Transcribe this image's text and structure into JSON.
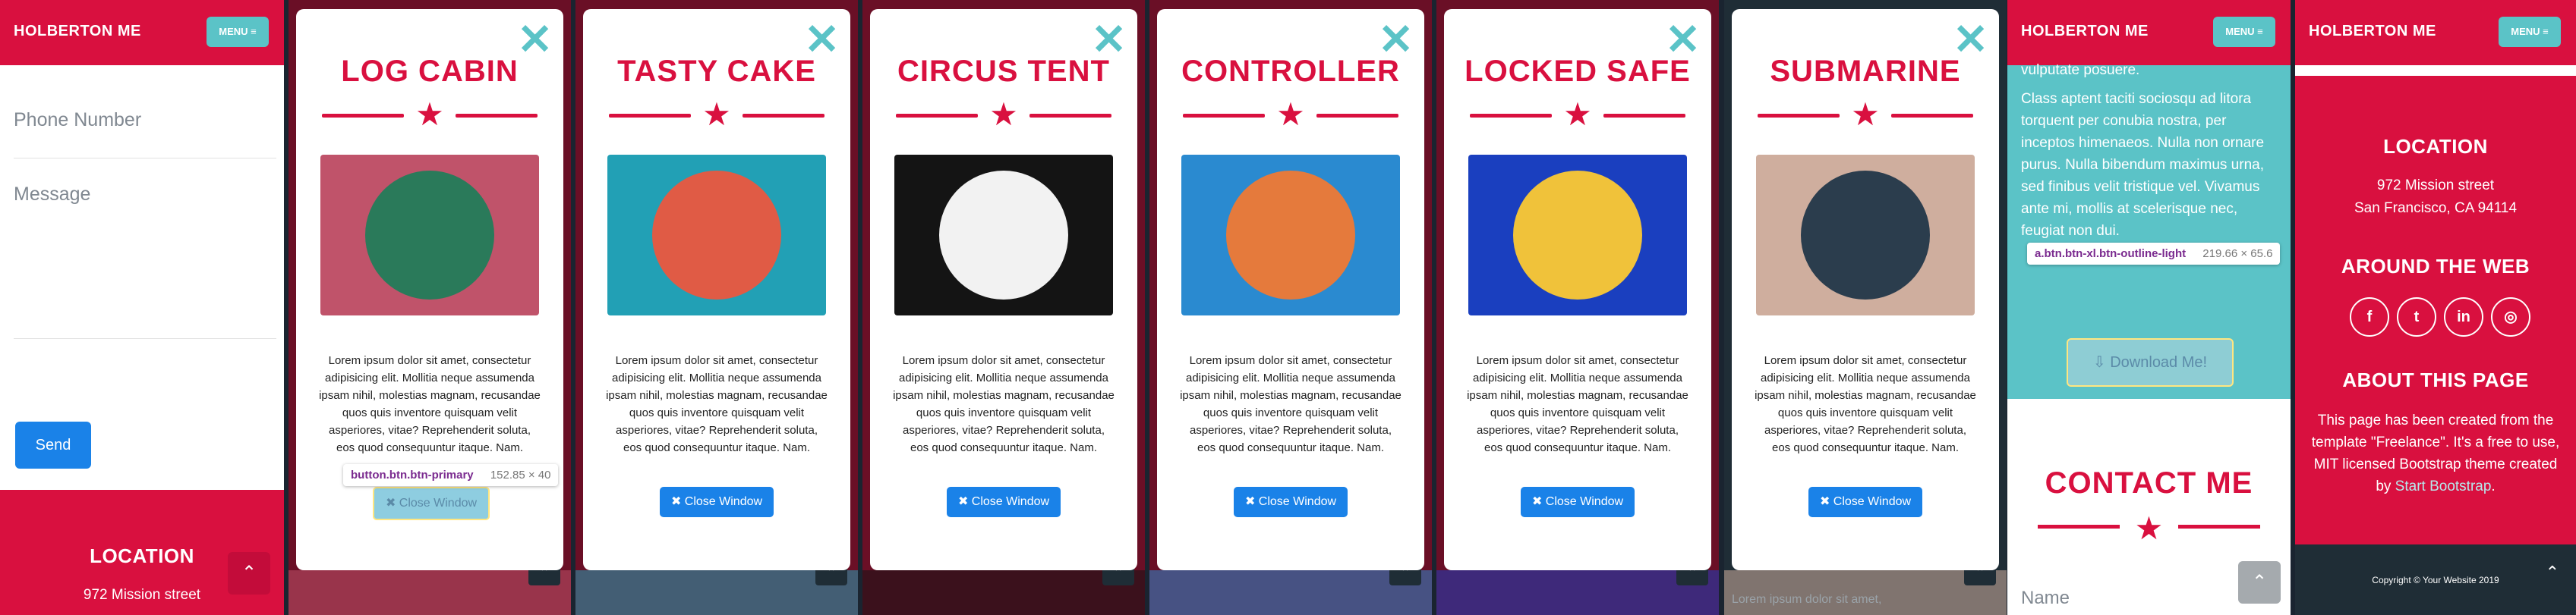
{
  "nav": {
    "brand": "HOLBERTON ME",
    "menu": "MENU ≡"
  },
  "contact_form": {
    "phone_placeholder": "Phone Number",
    "message_placeholder": "Message",
    "send": "Send",
    "name_placeholder": "Name"
  },
  "footer": {
    "location_title": "LOCATION",
    "address_line1": "972 Mission street",
    "address_line2": "San Francisco, CA 94114",
    "around_title": "AROUND THE WEB",
    "about_title": "ABOUT THIS PAGE",
    "about_text_1": "This page has been created from the template \"Freelance\". It's a free to use, MIT licensed Bootstrap theme created by",
    "about_link": "Start Bootstrap",
    "about_end": ".",
    "copyright": "Copyright © Your Website 2019"
  },
  "social_icons": [
    "facebook-icon",
    "twitter-icon",
    "linkedin-icon",
    "dribbble-icon"
  ],
  "modal_common": {
    "close_x": "✕",
    "star": "★",
    "body": "Lorem ipsum dolor sit amet, consectetur adipisicing elit. Mollitia neque assumenda ipsam nihil, molestias magnam, recusandae quos quis inventore quisquam velit asperiores, vitae? Reprehenderit soluta, eos quod consequuntur itaque. Nam.",
    "close_button": "✖ Close Window"
  },
  "modals": [
    {
      "title": "LOG CABIN",
      "bg": "#c0536a",
      "circle": "#2a7a5a",
      "icon": "cabin-icon"
    },
    {
      "title": "TASTY CAKE",
      "bg": "#22a0b5",
      "circle": "#e05b45",
      "icon": "cake-icon"
    },
    {
      "title": "CIRCUS TENT",
      "bg": "#141414",
      "circle": "#f2f2f2",
      "icon": "tent-icon"
    },
    {
      "title": "CONTROLLER",
      "bg": "#2a8ad0",
      "circle": "#e57a3c",
      "icon": "gamepad-icon"
    },
    {
      "title": "LOCKED SAFE",
      "bg": "#1a3fbf",
      "circle": "#f0c23a",
      "icon": "safe-icon"
    },
    {
      "title": "SUBMARINE",
      "bg": "#cfae9e",
      "circle": "#2b3d4d",
      "icon": "submarine-icon"
    }
  ],
  "devtools": {
    "button_selector": "button.btn.btn-primary",
    "button_size": "152.85 × 40",
    "link_selector": "a.btn.btn-xl.btn-outline-light",
    "link_size": "219.66 × 65.6"
  },
  "about_section": {
    "text_top": "vulputate posuere.",
    "text_main": "Class aptent taciti sociosqu ad litora torquent per conubia nostra, per inceptos himenaeos. Nulla non ornare purus. Nulla bibendum maximus urna, sed finibus velit tristique vel. Vivamus ante mi, mollis at scelerisque nec, feugiat non dui.",
    "download": "⇩ Download Me!"
  },
  "contact_title": "CONTACT ME",
  "scroll_icon": "⌃",
  "peek_text": "Lorem ipsum dolor sit amet,"
}
